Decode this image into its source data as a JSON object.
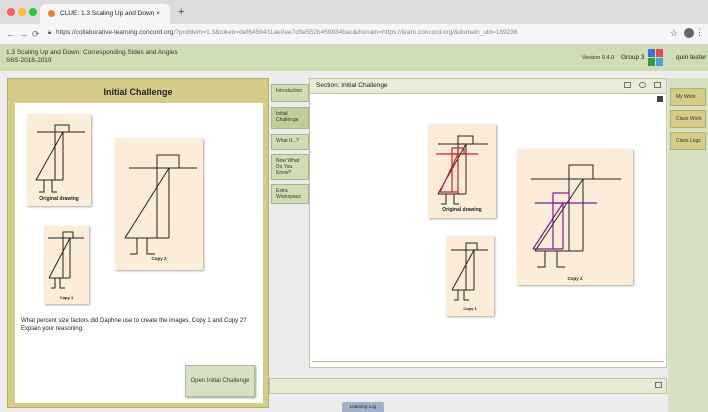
{
  "browser": {
    "tab_title": "CLUE: 1.3 Scaling Up and Down ×",
    "tab_close": "×",
    "new_tab": "+",
    "url_host": "https://collaborative-learning.concord.org",
    "url_path": "/?problem=1.3&token=def6459431ae0ee7d3e552b459834bac&domain=https://learn.concord.org/&domain_uid=189236"
  },
  "app": {
    "title_line1": "1.3 Scaling Up and Down: Corresponding Sides and Angles",
    "title_line2": "S6S-2018-2019",
    "version": "Version 0.4.0",
    "group": "Group 3",
    "user": "quin tester",
    "colors": {
      "header": "#cfddb5",
      "panel": "#d6cc8a",
      "card": "#fdecd8",
      "red": "#cc2222",
      "purple": "#7a1f8c"
    }
  },
  "left_panel": {
    "title": "Initial Challenge",
    "labels": {
      "original": "Original drawing",
      "copy1": "Copy 1",
      "copy2": "Copy 2"
    },
    "question": "What percent size factors did Daphne use to create the images, Copy 1 and Copy 2? Explain your reasoning.",
    "open_button": "Open Initial Challenge"
  },
  "section_tabs": [
    {
      "label": "Introduction",
      "active": false
    },
    {
      "label": "Initial Challenge",
      "active": true
    },
    {
      "label": "What If...?",
      "active": false
    },
    {
      "label": "Now What Do You Know?",
      "active": false
    },
    {
      "label": "Extra Workspace",
      "active": false
    }
  ],
  "main": {
    "section_title": "Section: Initial Challenge",
    "labels": {
      "original": "Original drawing",
      "copy1": "Copy 1",
      "copy2": "Copy 2"
    }
  },
  "bottom": {
    "learning_log": "Learning Log"
  },
  "right_panel": [
    "My Work",
    "Class Work",
    "Class Logs"
  ]
}
